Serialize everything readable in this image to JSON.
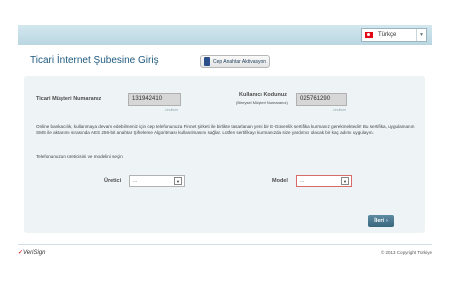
{
  "header": {
    "language": {
      "selected": "Türkçe",
      "flag_color": "#e30a17"
    }
  },
  "page": {
    "title": "Ticari İnternet Şubesine Giriş",
    "otp_button_label": "Cep Anahtar Aktivasyon"
  },
  "form": {
    "customer_number": {
      "label": "Ticari Müşteri Numaranız",
      "value": "131942410",
      "hint": "Unuttum"
    },
    "username": {
      "label": "Kullanıcı Kodunuz",
      "sublabel": "(Bireysel Müşteri Numaranız)",
      "value": "025761290",
      "hint": "Unuttum"
    },
    "info_text": "Online bankacılık, kullanmaya devam edebilmeniz için cep telefonunuza Finnet şirketi ile birlikte tasarlanan yeni bir E-Güvenlik sertifika kurmanız gerekmektedir! Bu sertifika, uygulamanın SMS ile aktarımı sırasında AES 256-bit anahtar Şifreleme Algoritması kullanılmasını sağlar. Lütfen sertifikayı kurmanızda size yardımcı olacak bir kaç adımı uygulayın.",
    "device_prompt": "Telefonunuzun üreticisini ve modelini seçin",
    "manufacturer": {
      "label": "Üretici",
      "value": "..."
    },
    "model": {
      "label": "Model",
      "value": "..."
    },
    "next_label": "İleri",
    "next_arrow": "›"
  },
  "footer": {
    "logo_text": "VeriSign",
    "logo_mark": "✓",
    "copyright": "© 2013 Copyright Türkiye"
  },
  "colors": {
    "accent": "#1f5a7e",
    "panel": "#eef4f6",
    "error_border": "#d86a6a"
  }
}
